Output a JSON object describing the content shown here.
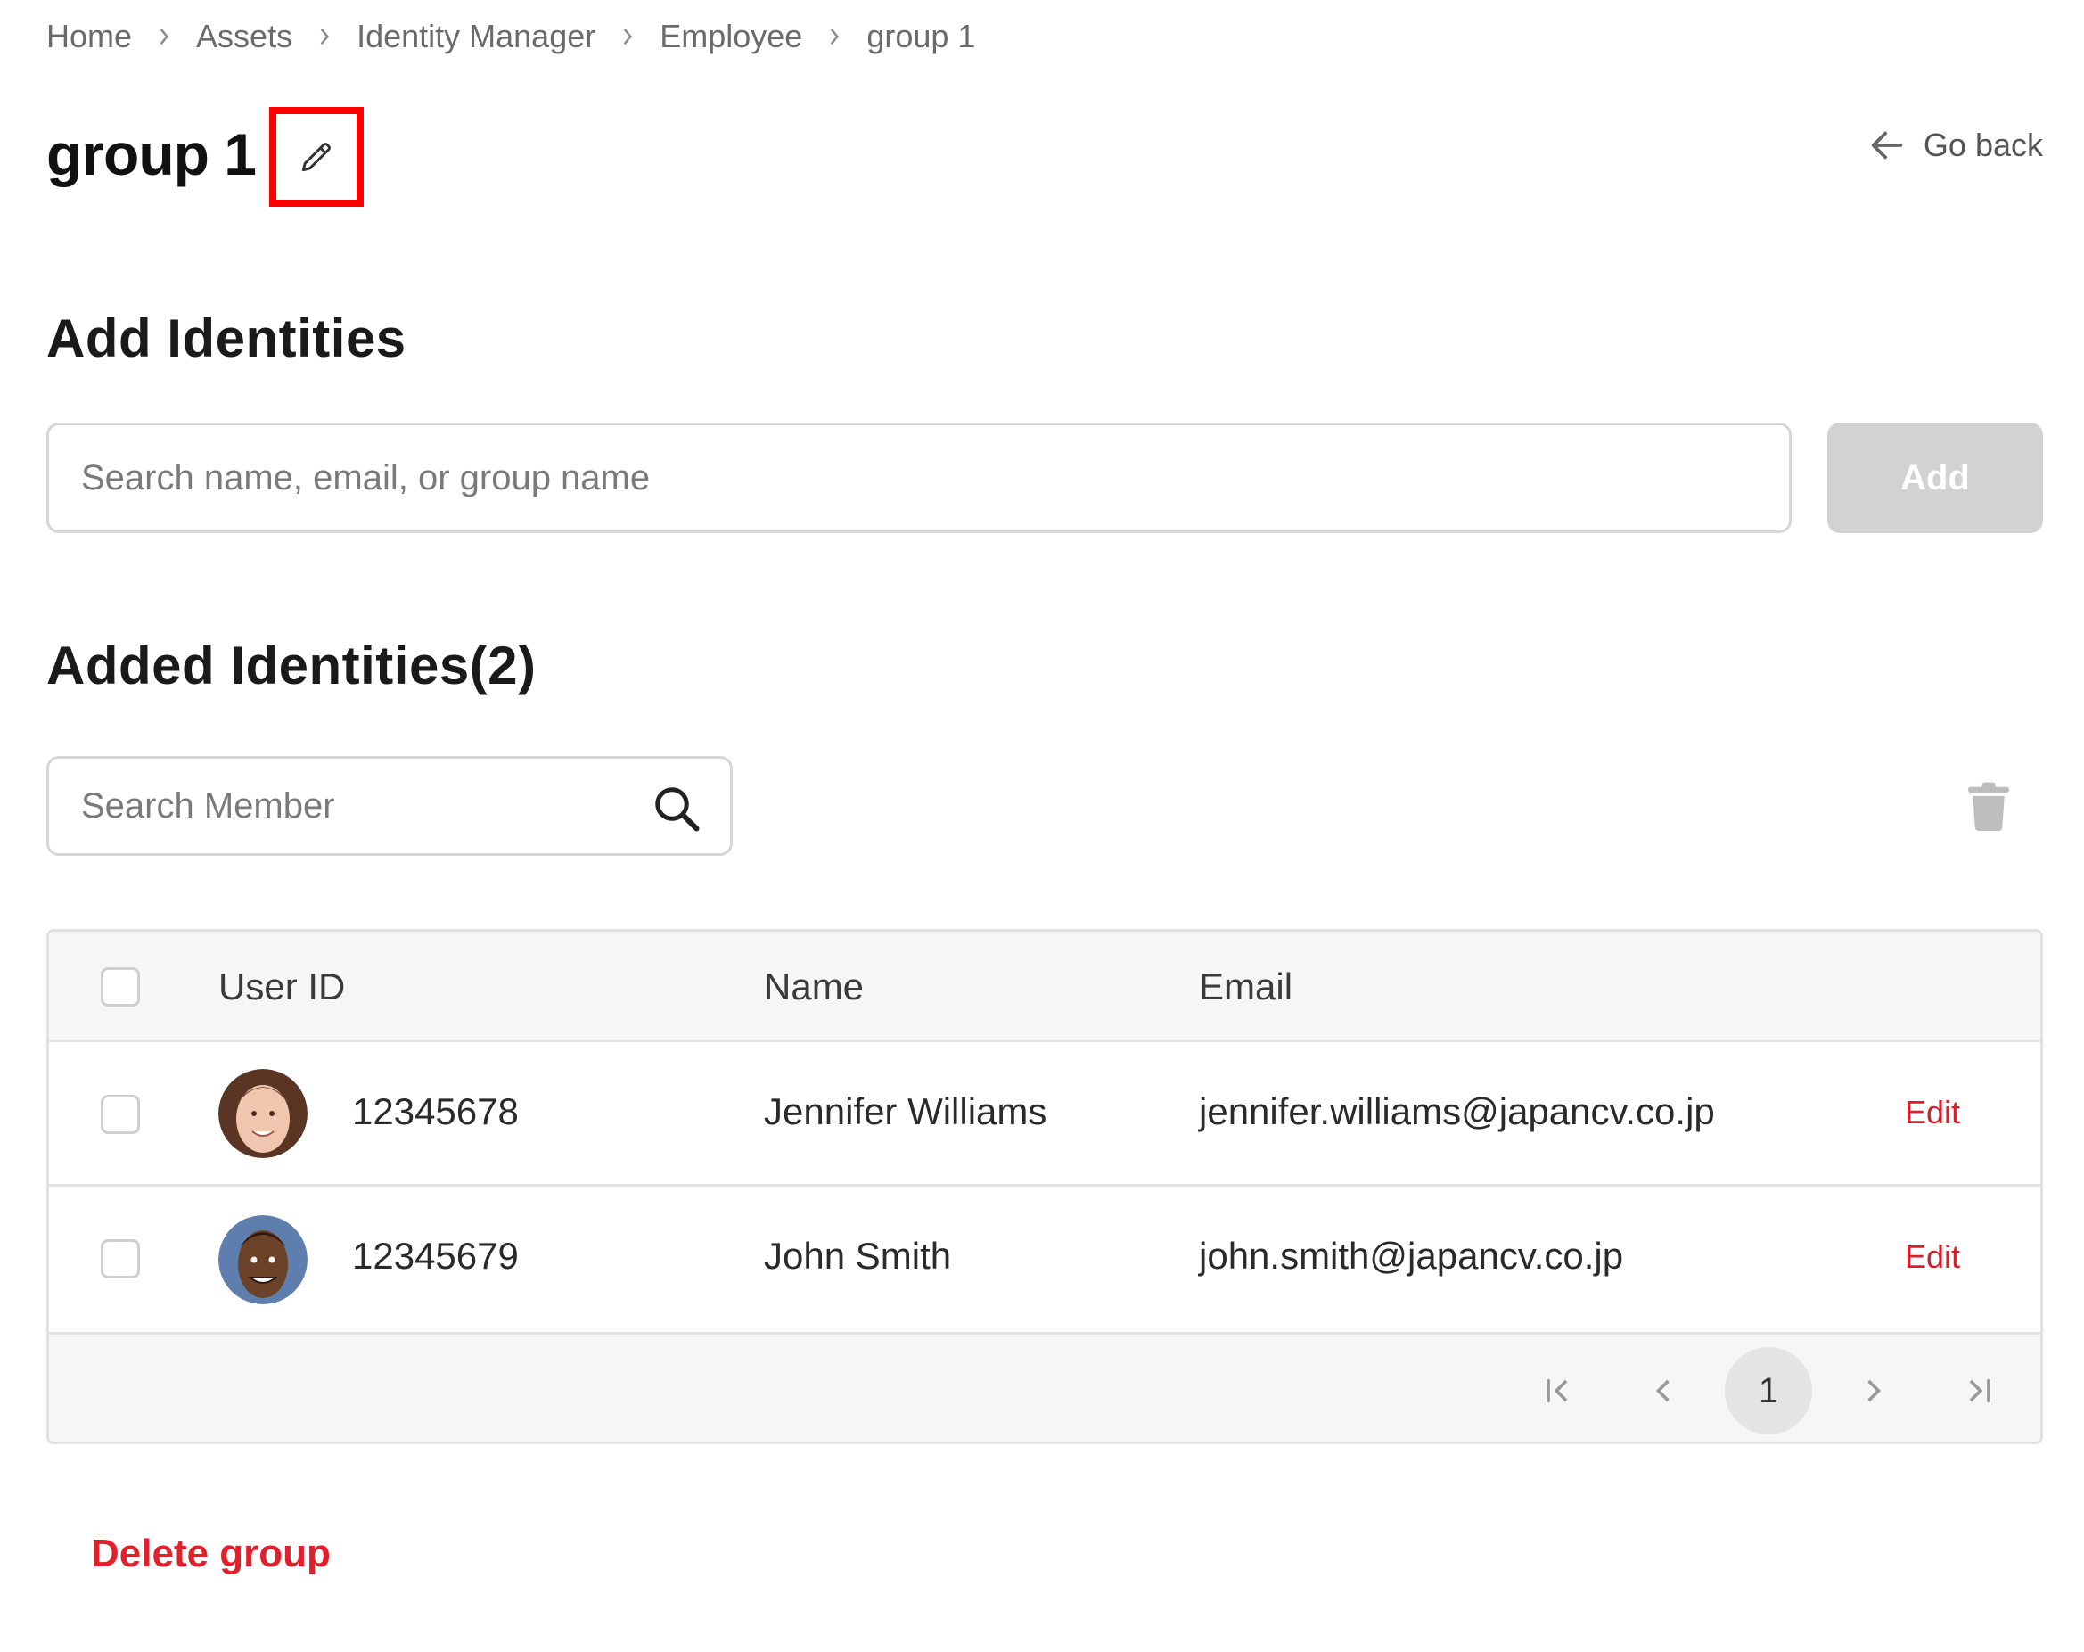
{
  "breadcrumb": {
    "items": [
      {
        "label": "Home"
      },
      {
        "label": "Assets"
      },
      {
        "label": "Identity Manager"
      },
      {
        "label": "Employee"
      },
      {
        "label": "group 1"
      }
    ]
  },
  "header": {
    "title": "group 1",
    "edit_icon": "pencil-icon",
    "go_back_label": "Go back",
    "go_back_icon": "arrow-left-icon"
  },
  "add_section": {
    "title": "Add Identities",
    "search_placeholder": "Search name, email, or group name",
    "search_value": "",
    "add_label": "Add",
    "add_disabled": true
  },
  "added_section": {
    "title": "Added Identities(2)",
    "count": 2,
    "member_search_placeholder": "Search Member",
    "member_search_value": "",
    "delete_icon": "trash-icon"
  },
  "table": {
    "columns": [
      "User ID",
      "Name",
      "Email"
    ],
    "rows": [
      {
        "user_id": "12345678",
        "name": "Jennifer Williams",
        "email": "jennifer.williams@japancv.co.jp",
        "action": "Edit",
        "checked": false
      },
      {
        "user_id": "12345679",
        "name": "John Smith",
        "email": "john.smith@japancv.co.jp",
        "action": "Edit",
        "checked": false
      }
    ],
    "pagination": {
      "current_page": "1",
      "first_icon": "first-page-icon",
      "prev_icon": "chevron-left-icon",
      "next_icon": "chevron-right-icon",
      "last_icon": "last-page-icon"
    }
  },
  "footer": {
    "delete_group_label": "Delete group"
  },
  "colors": {
    "accent_red": "#e2202c",
    "highlight_box": "#ff0000",
    "disabled_button": "#d2d2d2",
    "table_header_bg": "#f6f6f6"
  }
}
